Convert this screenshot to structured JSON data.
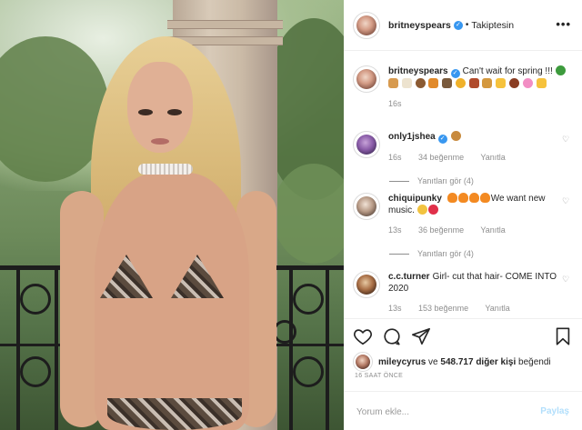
{
  "post": {
    "username": "britneyspears",
    "follow_status": "Takiptesin",
    "more_label": "•••"
  },
  "caption": {
    "username": "britneyspears",
    "text": "Can't wait for spring !!!",
    "emojis": [
      "clover",
      "bread",
      "bone",
      "monkey",
      "butterfly",
      "moth",
      "chick",
      "boot",
      "baguette",
      "star",
      "football",
      "flower",
      "star"
    ],
    "time": "16s"
  },
  "comments": [
    {
      "username": "only1jshea",
      "verified": true,
      "text": "",
      "emojis": [
        "cookie"
      ],
      "time": "16s",
      "likes": "34 beğenme",
      "reply": "Yanıtla",
      "view_replies": "Yanıtları gör (4)"
    },
    {
      "username": "chiquipunky",
      "verified": false,
      "text": "We want new music.",
      "emojis": [
        "fire",
        "fire",
        "fire",
        "fire"
      ],
      "end_emojis": [
        "grimace",
        "heart"
      ],
      "time": "13s",
      "likes": "36 beğenme",
      "reply": "Yanıtla",
      "view_replies": "Yanıtları gör (4)"
    },
    {
      "username": "c.c.turner",
      "verified": false,
      "text": "Girl- cut that hair- COME INTO 2020",
      "time": "13s",
      "likes": "153 beğenme",
      "reply": "Yanıtla"
    }
  ],
  "likes": {
    "first": "mileycyrus",
    "joiner": "ve",
    "others": "548.717 diğer kişi",
    "verb": "beğendi"
  },
  "timestamp": "16 SAAT ÖNCE",
  "add_comment": {
    "placeholder": "Yorum ekle...",
    "send_label": "Paylaş"
  },
  "colors": {
    "link_blue": "#3897f0",
    "muted": "#8e8e8e",
    "border": "#efefef"
  },
  "icons": [
    "heart-icon",
    "comment-icon",
    "share-icon",
    "bookmark-icon",
    "verified-badge-icon",
    "more-icon"
  ]
}
